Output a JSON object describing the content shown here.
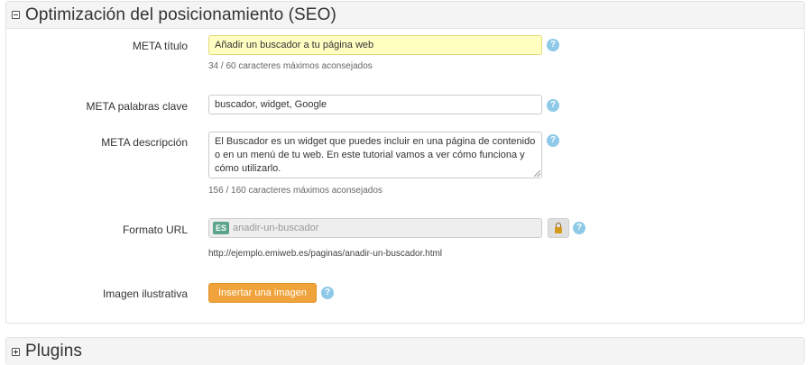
{
  "seo_panel": {
    "title": "Optimización del posicionamiento (SEO)",
    "meta_title": {
      "label": "META título",
      "value": "Añadir un buscador a tu página web",
      "hint": "34 / 60 caracteres máximos aconsejados"
    },
    "meta_keywords": {
      "label": "META palabras clave",
      "value": "buscador, widget, Google"
    },
    "meta_description": {
      "label": "META descripción",
      "value": "El Buscador es un widget que puedes incluir en una página de contenido o en un menú de tu web. En este tutorial vamos a ver cómo funciona y cómo utilizarlo.",
      "hint": "156 / 160 caracteres máximos aconsejados"
    },
    "url_format": {
      "label": "Formato URL",
      "lang": "ES",
      "value": "anadir-un-buscador",
      "full_url": "http://ejemplo.emiweb.es/paginas/anadir-un-buscador.html"
    },
    "image": {
      "label": "Imagen ilustrativa",
      "button": "Insertar una imagen"
    },
    "help_symbol": "?"
  },
  "plugins_panel": {
    "title": "Plugins"
  },
  "colors": {
    "help": "#8ec9e8",
    "highlight": "#ffffc2",
    "button": "#f0a33a",
    "lang_badge": "#5aa58a"
  }
}
